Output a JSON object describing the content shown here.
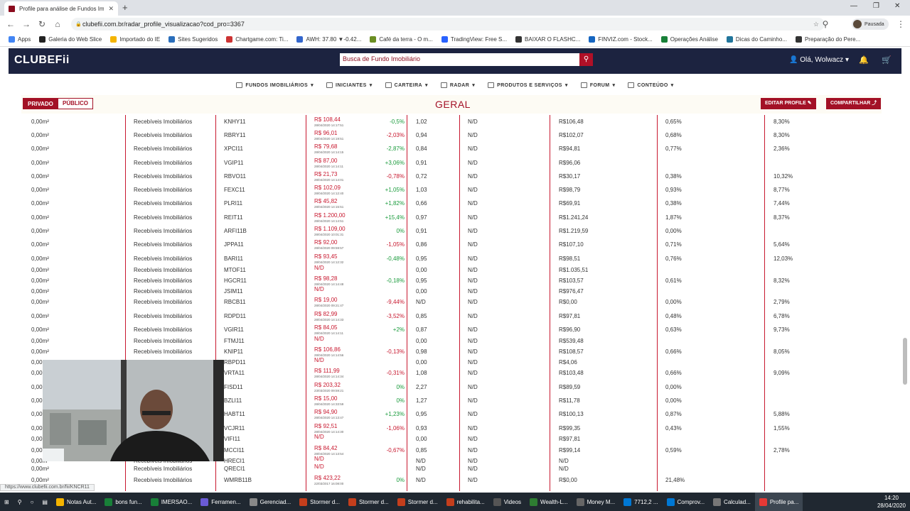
{
  "browser": {
    "tab_title": "Profile para análise de Fundos Im",
    "url": "clubefii.com.br/radar_profile_visualizacao?cod_pro=3367",
    "profile_label": "Pausada",
    "status_url": "https://www.clubefii.com.br/fii/KNCR11",
    "bookmarks": [
      "Apps",
      "Galeria do Web Slice",
      "Importado do IE",
      "Sites Sugeridos",
      "Chartgame.com: Ti...",
      "AWH: 37.80 ▼-0.42...",
      "Café da terra - O m...",
      "TradingView: Free S...",
      "BAIXAR O FLASHC...",
      "FINVIZ.com - Stock...",
      "Operações Análise",
      "Dicas do Caminho...",
      "Preparação do Pere..."
    ]
  },
  "site": {
    "logo": "CLUBEFii",
    "search_placeholder": "Busca de Fundo Imobiliário",
    "greeting": "Olá, Wolwacz",
    "menu": [
      "FUNDOS IMOBILIÁRIOS",
      "INICIANTES",
      "CARTEIRA",
      "RADAR",
      "PRODUTOS E SERVIÇOS",
      "FORUM",
      "CONTEÚDO"
    ],
    "btn_private": "PRIVADO",
    "btn_public": "PÚBLICO",
    "section_title": "GERAL",
    "btn_edit": "EDITAR PROFILE",
    "btn_share": "COMPARTILHAR"
  },
  "table": {
    "rows": [
      {
        "area": "0,00m²",
        "seg": "Recebíveis Imobiliários",
        "ticker": "KNHY11",
        "price": "R$ 108,44",
        "date": "28/04/2020 14:17:51",
        "var": "-0,5%",
        "var_dir": "pos",
        "pvp": "1,02",
        "c6": "N/D",
        "vpa": "R$106,48",
        "dy": "0,65%",
        "dy12": "8,30%"
      },
      {
        "area": "0,00m²",
        "seg": "Recebíveis Imobiliários",
        "ticker": "RBRY11",
        "price": "R$ 96,01",
        "date": "28/04/2020 14:19:51",
        "var": "-2,03%",
        "var_dir": "neg",
        "pvp": "0,94",
        "c6": "N/D",
        "vpa": "R$102,07",
        "dy": "0,68%",
        "dy12": "8,30%"
      },
      {
        "area": "0,00m²",
        "seg": "Recebíveis Imobiliários",
        "ticker": "XPCI11",
        "price": "R$ 79,68",
        "date": "28/04/2020 14:14:15",
        "var": "-2,87%",
        "var_dir": "pos",
        "pvp": "0,84",
        "c6": "N/D",
        "vpa": "R$94,81",
        "dy": "0,77%",
        "dy12": "2,36%"
      },
      {
        "area": "0,00m²",
        "seg": "Recebíveis Imobiliários",
        "ticker": "VGIP11",
        "price": "R$ 87,00",
        "date": "28/04/2020 14:14:11",
        "var": "+3,06%",
        "var_dir": "pos",
        "pvp": "0,91",
        "c6": "N/D",
        "vpa": "R$96,06",
        "dy": "",
        "dy12": ""
      },
      {
        "area": "0,00m²",
        "seg": "Recebíveis Imobiliários",
        "ticker": "RBVO11",
        "price": "R$ 21,73",
        "date": "28/04/2020 14:14:01",
        "var": "-0,78%",
        "var_dir": "neg",
        "pvp": "0,72",
        "c6": "N/D",
        "vpa": "R$30,17",
        "dy": "0,38%",
        "dy12": "10,32%"
      },
      {
        "area": "0,00m²",
        "seg": "Recebíveis Imobiliários",
        "ticker": "FEXC11",
        "price": "R$ 102,09",
        "date": "28/04/2020 14:12:40",
        "var": "+1,05%",
        "var_dir": "pos",
        "pvp": "1,03",
        "c6": "N/D",
        "vpa": "R$98,79",
        "dy": "0,93%",
        "dy12": "8,77%"
      },
      {
        "area": "0,00m²",
        "seg": "Recebíveis Imobiliários",
        "ticker": "PLRI11",
        "price": "R$ 45,82",
        "date": "28/04/2020 14:15:51",
        "var": "+1,82%",
        "var_dir": "pos",
        "pvp": "0,66",
        "c6": "N/D",
        "vpa": "R$69,91",
        "dy": "0,38%",
        "dy12": "7,44%"
      },
      {
        "area": "0,00m²",
        "seg": "Recebíveis Imobiliários",
        "ticker": "REIT11",
        "price": "R$ 1.200,00",
        "date": "28/04/2020 14:14:51",
        "var": "+15,4%",
        "var_dir": "pos",
        "pvp": "0,97",
        "c6": "N/D",
        "vpa": "R$1.241,24",
        "dy": "1,87%",
        "dy12": "8,37%"
      },
      {
        "area": "0,00m²",
        "seg": "Recebíveis Imobiliários",
        "ticker": "ARFI11B",
        "price": "R$ 1.109,00",
        "date": "28/04/2020 10:01:31",
        "var": "0%",
        "var_dir": "pos",
        "pvp": "0,91",
        "c6": "N/D",
        "vpa": "R$1.219,59",
        "dy": "0,00%",
        "dy12": ""
      },
      {
        "area": "0,00m²",
        "seg": "Recebíveis Imobiliários",
        "ticker": "JPPA11",
        "price": "R$ 92,00",
        "date": "28/04/2020 09:59:57",
        "var": "-1,05%",
        "var_dir": "neg",
        "pvp": "0,86",
        "c6": "N/D",
        "vpa": "R$107,10",
        "dy": "0,71%",
        "dy12": "5,64%"
      },
      {
        "area": "0,00m²",
        "seg": "Recebíveis Imobiliários",
        "ticker": "BARI11",
        "price": "R$ 93,45",
        "date": "28/04/2020 14:12:32",
        "var": "-0,48%",
        "var_dir": "pos",
        "pvp": "0,95",
        "c6": "N/D",
        "vpa": "R$98,51",
        "dy": "0,76%",
        "dy12": "12,03%"
      },
      {
        "area": "0,00m²",
        "seg": "Recebíveis Imobiliários",
        "ticker": "MTOF11",
        "price": "N/D",
        "date": "",
        "var": "",
        "var_dir": "pos",
        "pvp": "0,00",
        "c6": "N/D",
        "vpa": "R$1.035,51",
        "dy": "",
        "dy12": ""
      },
      {
        "area": "0,00m²",
        "seg": "Recebíveis Imobiliários",
        "ticker": "HGCR11",
        "price": "R$ 98,28",
        "date": "28/04/2020 14:14:48",
        "var": "-0,18%",
        "var_dir": "pos",
        "pvp": "0,95",
        "c6": "N/D",
        "vpa": "R$103,57",
        "dy": "0,61%",
        "dy12": "8,32%"
      },
      {
        "area": "0,00m²",
        "seg": "Recebíveis Imobiliários",
        "ticker": "JSIM11",
        "price": "N/D",
        "date": "",
        "var": "",
        "var_dir": "pos",
        "pvp": "0,00",
        "c6": "N/D",
        "vpa": "R$976,47",
        "dy": "",
        "dy12": ""
      },
      {
        "area": "0,00m²",
        "seg": "Recebíveis Imobiliários",
        "ticker": "RBCB11",
        "price": "R$ 19,00",
        "date": "28/04/2020 09:21:47",
        "var": "-9,44%",
        "var_dir": "neg",
        "pvp": "N/D",
        "c6": "N/D",
        "vpa": "R$0,00",
        "dy": "0,00%",
        "dy12": "2,79%"
      },
      {
        "area": "0,00m²",
        "seg": "Recebíveis Imobiliários",
        "ticker": "RDPD11",
        "price": "R$ 82,99",
        "date": "28/04/2020 14:14:33",
        "var": "-3,52%",
        "var_dir": "neg",
        "pvp": "0,85",
        "c6": "N/D",
        "vpa": "R$97,81",
        "dy": "0,48%",
        "dy12": "6,78%"
      },
      {
        "area": "0,00m²",
        "seg": "Recebíveis Imobiliários",
        "ticker": "VGIR11",
        "price": "R$ 84,05",
        "date": "28/04/2020 14:14:11",
        "var": "+2%",
        "var_dir": "pos",
        "pvp": "0,87",
        "c6": "N/D",
        "vpa": "R$96,90",
        "dy": "0,63%",
        "dy12": "9,73%"
      },
      {
        "area": "0,00m²",
        "seg": "Recebíveis Imobiliários",
        "ticker": "FTMJ11",
        "price": "N/D",
        "date": "",
        "var": "",
        "var_dir": "pos",
        "pvp": "0,00",
        "c6": "N/D",
        "vpa": "R$539,48",
        "dy": "",
        "dy12": ""
      },
      {
        "area": "0,00m²",
        "seg": "Recebíveis Imobiliários",
        "ticker": "KNIP11",
        "price": "R$ 106,86",
        "date": "28/04/2020 14:14:56",
        "var": "-0,13%",
        "var_dir": "neg",
        "pvp": "0,98",
        "c6": "N/D",
        "vpa": "R$108,57",
        "dy": "0,66%",
        "dy12": "8,05%"
      },
      {
        "area": "0,00m²",
        "seg": "Recebíveis Imobiliários",
        "ticker": "RBPD11",
        "price": "N/D",
        "date": "",
        "var": "",
        "var_dir": "pos",
        "pvp": "0,00",
        "c6": "N/D",
        "vpa": "R$4,06",
        "dy": "",
        "dy12": ""
      },
      {
        "area": "0,00m²",
        "seg": "Recebíveis Imobiliários",
        "ticker": "VRTA11",
        "price": "R$ 111,99",
        "date": "28/04/2020 14:14:34",
        "var": "-0,31%",
        "var_dir": "neg",
        "pvp": "1,08",
        "c6": "N/D",
        "vpa": "R$103,48",
        "dy": "0,66%",
        "dy12": "9,09%"
      },
      {
        "area": "0,00m²",
        "seg": "Recebíveis Imobiliários",
        "ticker": "FISD11",
        "price": "R$ 203,32",
        "date": "23/03/2020 09:59:21",
        "var": "0%",
        "var_dir": "pos",
        "pvp": "2,27",
        "c6": "N/D",
        "vpa": "R$89,59",
        "dy": "0,00%",
        "dy12": ""
      },
      {
        "area": "0,00m²",
        "seg": "Recebíveis Imobiliários",
        "ticker": "BZLI11",
        "price": "R$ 15,00",
        "date": "28/04/2020 14:33:59",
        "var": "0%",
        "var_dir": "pos",
        "pvp": "1,27",
        "c6": "N/D",
        "vpa": "R$11,78",
        "dy": "0,00%",
        "dy12": ""
      },
      {
        "area": "0,00m²",
        "seg": "Recebíveis Imobiliários",
        "ticker": "HABT11",
        "price": "R$ 94,90",
        "date": "28/04/2020 14:13:47",
        "var": "+1,23%",
        "var_dir": "pos",
        "pvp": "0,95",
        "c6": "N/D",
        "vpa": "R$100,13",
        "dy": "0,87%",
        "dy12": "5,88%"
      },
      {
        "area": "0,00m²",
        "seg": "Recebíveis Imobiliários",
        "ticker": "VCJR11",
        "price": "R$ 92,51",
        "date": "28/04/2020 14:14:30",
        "var": "-1,06%",
        "var_dir": "neg",
        "pvp": "0,93",
        "c6": "N/D",
        "vpa": "R$99,35",
        "dy": "0,43%",
        "dy12": "1,55%"
      },
      {
        "area": "0,00m²",
        "seg": "Recebíveis Imobiliários",
        "ticker": "VIFI11",
        "price": "N/D",
        "date": "",
        "var": "",
        "var_dir": "pos",
        "pvp": "0,00",
        "c6": "N/D",
        "vpa": "R$97,81",
        "dy": "",
        "dy12": ""
      },
      {
        "area": "0,00m²",
        "seg": "Recebíveis Imobiliários",
        "ticker": "MCCI11",
        "price": "R$ 84,42",
        "date": "28/04/2020 14:13:54",
        "var": "-0,67%",
        "var_dir": "neg",
        "pvp": "0,85",
        "c6": "N/D",
        "vpa": "R$99,14",
        "dy": "0,59%",
        "dy12": "2,78%"
      },
      {
        "area": "0,00m²",
        "seg": "Recebíveis Imobiliários",
        "ticker": "HRECI1",
        "price": "N/D",
        "date": "",
        "var": "",
        "var_dir": "pos",
        "pvp": "N/D",
        "c6": "N/D",
        "vpa": "N/D",
        "dy": "",
        "dy12": ""
      },
      {
        "area": "0,00m²",
        "seg": "Recebíveis Imobiliários",
        "ticker": "QRECI1",
        "price": "N/D",
        "date": "",
        "var": "",
        "var_dir": "pos",
        "pvp": "N/D",
        "c6": "N/D",
        "vpa": "N/D",
        "dy": "",
        "dy12": ""
      },
      {
        "area": "0,00m²",
        "seg": "Recebíveis Imobiliários",
        "ticker": "WMRB11B",
        "price": "R$ 423,22",
        "date": "22/03/2017 16:08:00",
        "var": "0%",
        "var_dir": "pos",
        "pvp": "N/D",
        "c6": "N/D",
        "vpa": "R$0,00",
        "dy": "21,48%",
        "dy12": ""
      }
    ]
  },
  "taskbar": {
    "items": [
      "Notas Aut...",
      "bons fun...",
      "IMERSAO...",
      "Ferramen...",
      "Gerenciad...",
      "Stormer d...",
      "Stormer d...",
      "Stormer d...",
      "rehabilita...",
      "Videos",
      "Wealth-L...",
      "Money M...",
      "7712,2 ...",
      "Comprov...",
      "Calculad...",
      "Profile pa..."
    ],
    "time": "14:20",
    "date": "28/04/2020"
  }
}
